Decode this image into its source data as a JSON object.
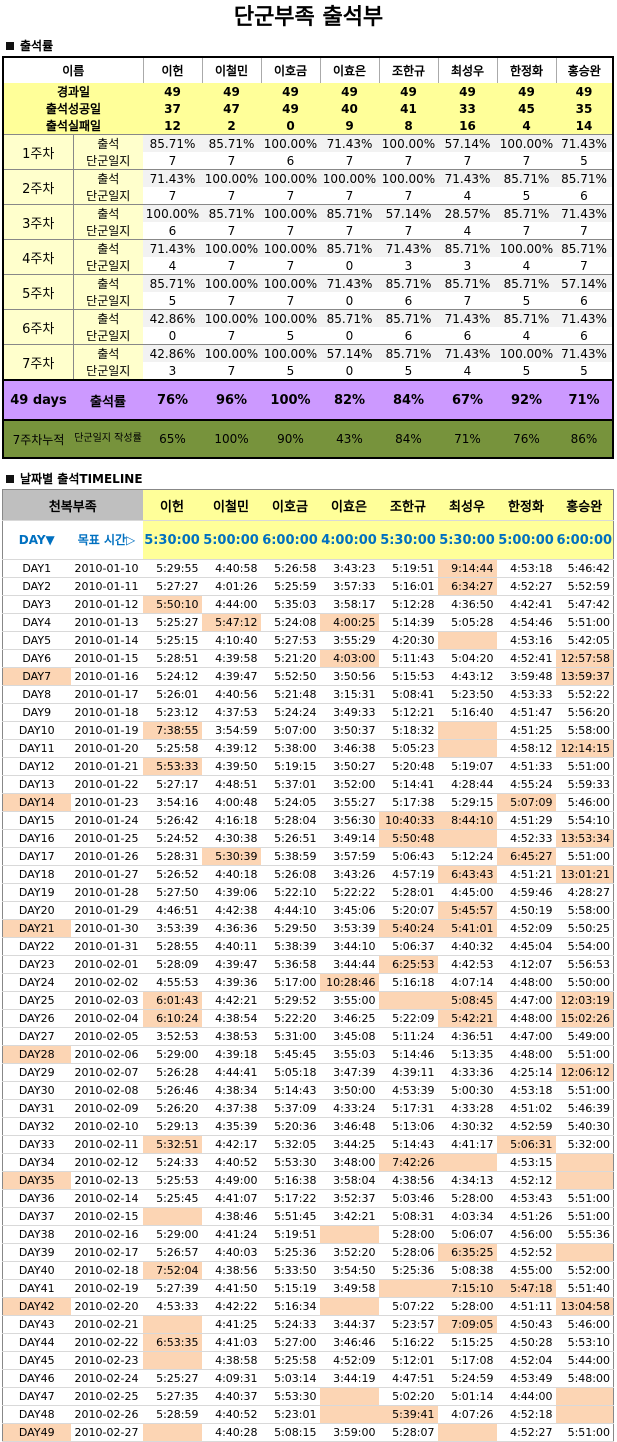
{
  "title": "단군부족 출석부",
  "summary": {
    "section_label": "출석률",
    "name_header": "이름",
    "names": [
      "이헌",
      "이철민",
      "이호금",
      "이효은",
      "조한규",
      "최성우",
      "한정화",
      "홍승완"
    ],
    "rows": [
      {
        "label": "경과일",
        "values": [
          "49",
          "49",
          "49",
          "49",
          "49",
          "49",
          "49",
          "49"
        ]
      },
      {
        "label": "출석성공일",
        "values": [
          "37",
          "47",
          "49",
          "40",
          "41",
          "33",
          "45",
          "35"
        ]
      },
      {
        "label": "출석실패일",
        "values": [
          "12",
          "2",
          "0",
          "9",
          "8",
          "16",
          "4",
          "14"
        ]
      }
    ],
    "attend_label": "출석",
    "journal_label": "단군일지",
    "weeks": [
      {
        "label": "1주차",
        "attend": [
          "85.71%",
          "85.71%",
          "100.00%",
          "71.43%",
          "100.00%",
          "57.14%",
          "100.00%",
          "71.43%"
        ],
        "journal": [
          "7",
          "7",
          "6",
          "7",
          "7",
          "7",
          "7",
          "5"
        ]
      },
      {
        "label": "2주차",
        "attend": [
          "71.43%",
          "100.00%",
          "100.00%",
          "100.00%",
          "100.00%",
          "71.43%",
          "85.71%",
          "85.71%"
        ],
        "journal": [
          "7",
          "7",
          "7",
          "7",
          "7",
          "4",
          "5",
          "6"
        ]
      },
      {
        "label": "3주차",
        "attend": [
          "100.00%",
          "85.71%",
          "100.00%",
          "85.71%",
          "57.14%",
          "28.57%",
          "85.71%",
          "71.43%"
        ],
        "journal": [
          "6",
          "7",
          "7",
          "7",
          "7",
          "4",
          "7",
          "7"
        ]
      },
      {
        "label": "4주차",
        "attend": [
          "71.43%",
          "100.00%",
          "100.00%",
          "85.71%",
          "71.43%",
          "85.71%",
          "100.00%",
          "85.71%"
        ],
        "journal": [
          "4",
          "7",
          "7",
          "0",
          "3",
          "3",
          "4",
          "7"
        ]
      },
      {
        "label": "5주차",
        "attend": [
          "85.71%",
          "100.00%",
          "100.00%",
          "71.43%",
          "85.71%",
          "85.71%",
          "85.71%",
          "57.14%"
        ],
        "journal": [
          "5",
          "7",
          "7",
          "0",
          "6",
          "7",
          "5",
          "6"
        ]
      },
      {
        "label": "6주차",
        "attend": [
          "42.86%",
          "100.00%",
          "100.00%",
          "85.71%",
          "85.71%",
          "71.43%",
          "85.71%",
          "71.43%"
        ],
        "journal": [
          "0",
          "7",
          "5",
          "0",
          "6",
          "6",
          "4",
          "6"
        ]
      },
      {
        "label": "7주차",
        "attend": [
          "42.86%",
          "100.00%",
          "100.00%",
          "57.14%",
          "85.71%",
          "71.43%",
          "100.00%",
          "71.43%"
        ],
        "journal": [
          "3",
          "7",
          "5",
          "0",
          "5",
          "4",
          "5",
          "5"
        ]
      }
    ],
    "total": {
      "days_label": "49 days",
      "rate_label": "출석률",
      "values": [
        "76%",
        "96%",
        "100%",
        "82%",
        "84%",
        "67%",
        "92%",
        "71%"
      ]
    },
    "cumulative": {
      "label": "7주차누적",
      "sublabel": "단군일지 작성률",
      "values": [
        "65%",
        "100%",
        "90%",
        "43%",
        "84%",
        "71%",
        "76%",
        "86%"
      ]
    }
  },
  "timeline": {
    "section_label": "날짜별 출석TIMELINE",
    "group_header": "천복부족",
    "names": [
      "이헌",
      "이철민",
      "이호금",
      "이효은",
      "조한규",
      "최성우",
      "한정화",
      "홍승완"
    ],
    "day_header": "DAY▼",
    "goal_header": "목표 시간▷",
    "targets": [
      "5:30:00",
      "5:00:00",
      "6:00:00",
      "4:00:00",
      "5:30:00",
      "5:30:00",
      "5:00:00",
      "6:00:00"
    ],
    "colors": {
      "highlight": "#fcd5b4",
      "target_bg": "#ffff99",
      "purple": "#cc99ff",
      "green": "#77933c"
    },
    "days": [
      {
        "day": "DAY1",
        "date": "2010-01-10",
        "times": [
          "5:29:55",
          "4:40:58",
          "5:26:58",
          "3:43:23",
          "5:19:51",
          "9:14:44",
          "4:53:18",
          "5:46:42"
        ],
        "hl": [
          5
        ]
      },
      {
        "day": "DAY2",
        "date": "2010-01-11",
        "times": [
          "5:27:27",
          "4:01:26",
          "5:25:59",
          "3:57:33",
          "5:16:01",
          "6:34:27",
          "4:52:27",
          "5:52:59"
        ],
        "hl": [
          5
        ]
      },
      {
        "day": "DAY3",
        "date": "2010-01-12",
        "times": [
          "5:50:10",
          "4:44:00",
          "5:35:03",
          "3:58:17",
          "5:12:28",
          "4:36:50",
          "4:42:41",
          "5:47:42"
        ],
        "hl": [
          0
        ]
      },
      {
        "day": "DAY4",
        "date": "2010-01-13",
        "times": [
          "5:25:27",
          "5:47:12",
          "5:24:08",
          "4:00:25",
          "5:14:39",
          "5:05:28",
          "4:54:46",
          "5:51:00"
        ],
        "hl": [
          1,
          3
        ]
      },
      {
        "day": "DAY5",
        "date": "2010-01-14",
        "times": [
          "5:25:15",
          "4:10:40",
          "5:27:53",
          "3:55:29",
          "4:20:30",
          "",
          "4:53:16",
          "5:42:05"
        ],
        "hl": [
          5
        ]
      },
      {
        "day": "DAY6",
        "date": "2010-01-15",
        "times": [
          "5:28:51",
          "4:39:58",
          "5:21:20",
          "4:03:00",
          "5:11:43",
          "5:04:20",
          "4:52:41",
          "12:57:58"
        ],
        "hl": [
          3,
          7
        ]
      },
      {
        "day": "DAY7",
        "date": "2010-01-16",
        "times": [
          "5:24:12",
          "4:39:47",
          "5:52:50",
          "3:50:56",
          "5:15:53",
          "4:43:12",
          "3:59:48",
          "13:59:37"
        ],
        "hl": [
          7
        ],
        "dhl": true
      },
      {
        "day": "DAY8",
        "date": "2010-01-17",
        "times": [
          "5:26:01",
          "4:40:56",
          "5:21:48",
          "3:15:31",
          "5:08:41",
          "5:23:50",
          "4:53:33",
          "5:52:22"
        ],
        "hl": []
      },
      {
        "day": "DAY9",
        "date": "2010-01-18",
        "times": [
          "5:23:12",
          "4:37:53",
          "5:24:24",
          "3:49:33",
          "5:12:21",
          "5:16:40",
          "4:51:47",
          "5:56:20"
        ],
        "hl": []
      },
      {
        "day": "DAY10",
        "date": "2010-01-19",
        "times": [
          "7:38:55",
          "3:54:59",
          "5:07:00",
          "3:50:37",
          "5:18:32",
          "",
          "4:51:25",
          "5:58:00"
        ],
        "hl": [
          0,
          5
        ]
      },
      {
        "day": "DAY11",
        "date": "2010-01-20",
        "times": [
          "5:25:58",
          "4:39:12",
          "5:38:00",
          "3:46:38",
          "5:05:23",
          "",
          "4:58:12",
          "12:14:15"
        ],
        "hl": [
          5,
          7
        ]
      },
      {
        "day": "DAY12",
        "date": "2010-01-21",
        "times": [
          "5:53:33",
          "4:39:50",
          "5:19:15",
          "3:50:27",
          "5:20:48",
          "5:19:07",
          "4:51:33",
          "5:51:00"
        ],
        "hl": [
          0
        ]
      },
      {
        "day": "DAY13",
        "date": "2010-01-22",
        "times": [
          "5:27:17",
          "4:48:51",
          "5:37:01",
          "3:52:00",
          "5:14:41",
          "4:28:44",
          "4:55:24",
          "5:59:33"
        ],
        "hl": []
      },
      {
        "day": "DAY14",
        "date": "2010-01-23",
        "times": [
          "3:54:16",
          "4:00:48",
          "5:24:05",
          "3:55:27",
          "5:17:38",
          "5:29:15",
          "5:07:09",
          "5:46:00"
        ],
        "hl": [
          6
        ],
        "dhl": true
      },
      {
        "day": "DAY15",
        "date": "2010-01-24",
        "times": [
          "5:26:42",
          "4:16:18",
          "5:28:04",
          "3:56:30",
          "10:40:33",
          "8:44:10",
          "4:51:29",
          "5:54:10"
        ],
        "hl": [
          4,
          5
        ]
      },
      {
        "day": "DAY16",
        "date": "2010-01-25",
        "times": [
          "5:24:52",
          "4:30:38",
          "5:26:51",
          "3:49:14",
          "5:50:48",
          "",
          "4:52:33",
          "13:53:34"
        ],
        "hl": [
          4,
          5,
          7
        ]
      },
      {
        "day": "DAY17",
        "date": "2010-01-26",
        "times": [
          "5:28:31",
          "5:30:39",
          "5:38:59",
          "3:57:59",
          "5:06:43",
          "5:12:24",
          "6:45:27",
          "5:51:00"
        ],
        "hl": [
          1,
          6
        ]
      },
      {
        "day": "DAY18",
        "date": "2010-01-27",
        "times": [
          "5:26:52",
          "4:40:18",
          "5:26:08",
          "3:43:26",
          "4:57:19",
          "6:43:43",
          "4:51:21",
          "13:01:21"
        ],
        "hl": [
          5,
          7
        ]
      },
      {
        "day": "DAY19",
        "date": "2010-01-28",
        "times": [
          "5:27:50",
          "4:39:06",
          "5:22:10",
          "5:22:22",
          "5:28:01",
          "4:45:00",
          "4:59:46",
          "4:28:27"
        ],
        "hl": []
      },
      {
        "day": "DAY20",
        "date": "2010-01-29",
        "times": [
          "4:46:51",
          "4:42:38",
          "4:44:10",
          "3:45:06",
          "5:20:07",
          "5:45:57",
          "4:50:19",
          "5:58:00"
        ],
        "hl": [
          5
        ]
      },
      {
        "day": "DAY21",
        "date": "2010-01-30",
        "times": [
          "3:53:39",
          "4:36:36",
          "5:29:50",
          "3:53:39",
          "5:40:24",
          "5:41:01",
          "4:52:09",
          "5:50:25"
        ],
        "hl": [
          4,
          5
        ],
        "dhl": true
      },
      {
        "day": "DAY22",
        "date": "2010-01-31",
        "times": [
          "5:28:55",
          "4:40:11",
          "5:38:39",
          "3:44:10",
          "5:06:37",
          "4:40:32",
          "4:45:04",
          "5:54:00"
        ],
        "hl": []
      },
      {
        "day": "DAY23",
        "date": "2010-02-01",
        "times": [
          "5:28:09",
          "4:39:47",
          "5:36:58",
          "3:44:44",
          "6:25:53",
          "4:42:53",
          "4:12:07",
          "5:56:53"
        ],
        "hl": [
          4
        ]
      },
      {
        "day": "DAY24",
        "date": "2010-02-02",
        "times": [
          "4:55:53",
          "4:39:36",
          "5:17:00",
          "10:28:46",
          "5:16:18",
          "4:07:14",
          "4:48:00",
          "5:50:00"
        ],
        "hl": [
          3
        ]
      },
      {
        "day": "DAY25",
        "date": "2010-02-03",
        "times": [
          "6:01:43",
          "4:42:21",
          "5:29:52",
          "3:55:00",
          "",
          "5:08:45",
          "4:47:00",
          "12:03:19"
        ],
        "hl": [
          0,
          4,
          5,
          7
        ]
      },
      {
        "day": "DAY26",
        "date": "2010-02-04",
        "times": [
          "6:10:24",
          "4:38:54",
          "5:22:20",
          "3:46:25",
          "5:22:09",
          "5:42:21",
          "4:48:00",
          "15:02:26"
        ],
        "hl": [
          0,
          5,
          7
        ]
      },
      {
        "day": "DAY27",
        "date": "2010-02-05",
        "times": [
          "3:52:53",
          "4:38:53",
          "5:31:00",
          "3:45:08",
          "5:11:24",
          "4:36:51",
          "4:47:00",
          "5:49:00"
        ],
        "hl": []
      },
      {
        "day": "DAY28",
        "date": "2010-02-06",
        "times": [
          "5:29:00",
          "4:39:18",
          "5:45:45",
          "3:55:03",
          "5:14:46",
          "5:13:35",
          "4:48:00",
          "5:51:00"
        ],
        "hl": [],
        "dhl": true
      },
      {
        "day": "DAY29",
        "date": "2010-02-07",
        "times": [
          "5:26:28",
          "4:44:41",
          "5:05:18",
          "3:47:39",
          "4:39:11",
          "4:33:36",
          "4:25:14",
          "12:06:12"
        ],
        "hl": [
          7
        ]
      },
      {
        "day": "DAY30",
        "date": "2010-02-08",
        "times": [
          "5:26:46",
          "4:38:34",
          "5:14:43",
          "3:50:00",
          "4:53:39",
          "5:00:30",
          "4:53:18",
          "5:51:00"
        ],
        "hl": []
      },
      {
        "day": "DAY31",
        "date": "2010-02-09",
        "times": [
          "5:26:20",
          "4:37:38",
          "5:37:09",
          "4:33:24",
          "5:17:31",
          "4:33:28",
          "4:51:02",
          "5:46:39"
        ],
        "hl": []
      },
      {
        "day": "DAY32",
        "date": "2010-02-10",
        "times": [
          "5:29:13",
          "4:35:39",
          "5:20:36",
          "3:46:48",
          "5:13:06",
          "4:30:32",
          "4:52:59",
          "5:40:30"
        ],
        "hl": []
      },
      {
        "day": "DAY33",
        "date": "2010-02-11",
        "times": [
          "5:32:51",
          "4:42:17",
          "5:32:05",
          "3:44:25",
          "5:14:43",
          "4:41:17",
          "5:06:31",
          "5:32:00"
        ],
        "hl": [
          0,
          6
        ]
      },
      {
        "day": "DAY34",
        "date": "2010-02-12",
        "times": [
          "5:24:33",
          "4:40:52",
          "5:53:30",
          "3:48:00",
          "7:42:26",
          "",
          "4:53:15",
          ""
        ],
        "hl": [
          4,
          5,
          7
        ]
      },
      {
        "day": "DAY35",
        "date": "2010-02-13",
        "times": [
          "5:25:53",
          "4:49:00",
          "5:16:38",
          "3:58:04",
          "4:38:56",
          "4:34:13",
          "4:52:12",
          ""
        ],
        "hl": [
          7
        ],
        "dhl": true
      },
      {
        "day": "DAY36",
        "date": "2010-02-14",
        "times": [
          "5:25:45",
          "4:41:07",
          "5:17:22",
          "3:52:37",
          "5:03:46",
          "5:28:00",
          "4:53:43",
          "5:51:00"
        ],
        "hl": []
      },
      {
        "day": "DAY37",
        "date": "2010-02-15",
        "times": [
          "",
          "4:38:46",
          "5:51:45",
          "3:42:21",
          "5:08:31",
          "4:03:34",
          "4:51:26",
          "5:51:00"
        ],
        "hl": [
          0
        ]
      },
      {
        "day": "DAY38",
        "date": "2010-02-16",
        "times": [
          "5:29:00",
          "4:41:24",
          "5:19:51",
          "",
          "5:28:00",
          "5:06:07",
          "4:56:00",
          "5:55:36"
        ],
        "hl": [
          3
        ]
      },
      {
        "day": "DAY39",
        "date": "2010-02-17",
        "times": [
          "5:26:57",
          "4:40:03",
          "5:25:36",
          "3:52:20",
          "5:28:06",
          "6:35:25",
          "4:52:52",
          ""
        ],
        "hl": [
          5,
          7
        ]
      },
      {
        "day": "DAY40",
        "date": "2010-02-18",
        "times": [
          "7:52:04",
          "4:38:56",
          "5:33:50",
          "3:54:50",
          "5:25:36",
          "5:08:38",
          "4:55:00",
          "5:52:00"
        ],
        "hl": [
          0
        ]
      },
      {
        "day": "DAY41",
        "date": "2010-02-19",
        "times": [
          "5:27:39",
          "4:41:50",
          "5:15:19",
          "3:49:58",
          "",
          "7:15:10",
          "5:47:18",
          "5:51:40"
        ],
        "hl": [
          4,
          5,
          6
        ]
      },
      {
        "day": "DAY42",
        "date": "2010-02-20",
        "times": [
          "4:53:33",
          "4:42:22",
          "5:16:34",
          "",
          "5:07:22",
          "5:28:00",
          "4:51:11",
          "13:04:58"
        ],
        "hl": [
          3,
          7
        ],
        "dhl": true
      },
      {
        "day": "DAY43",
        "date": "2010-02-21",
        "times": [
          "",
          "4:41:25",
          "5:24:33",
          "3:44:37",
          "5:23:57",
          "7:09:05",
          "4:50:43",
          "5:46:00"
        ],
        "hl": [
          0,
          5
        ]
      },
      {
        "day": "DAY44",
        "date": "2010-02-22",
        "times": [
          "6:53:35",
          "4:41:03",
          "5:27:00",
          "3:46:46",
          "5:16:22",
          "5:15:25",
          "4:50:28",
          "5:53:10"
        ],
        "hl": [
          0
        ]
      },
      {
        "day": "DAY45",
        "date": "2010-02-23",
        "times": [
          "",
          "4:38:58",
          "5:25:58",
          "4:52:09",
          "5:12:01",
          "5:17:08",
          "4:52:04",
          "5:44:00"
        ],
        "hl": [
          0
        ]
      },
      {
        "day": "DAY46",
        "date": "2010-02-24",
        "times": [
          "5:25:27",
          "4:09:31",
          "5:03:14",
          "3:44:19",
          "4:47:51",
          "5:24:59",
          "4:53:49",
          "5:48:00"
        ],
        "hl": []
      },
      {
        "day": "DAY47",
        "date": "2010-02-25",
        "times": [
          "5:27:35",
          "4:40:37",
          "5:53:30",
          "",
          "5:02:20",
          "5:01:14",
          "4:44:00",
          ""
        ],
        "hl": [
          3,
          7
        ]
      },
      {
        "day": "DAY48",
        "date": "2010-02-26",
        "times": [
          "5:28:59",
          "4:40:52",
          "5:23:01",
          "",
          "5:39:41",
          "4:07:26",
          "4:52:18",
          ""
        ],
        "hl": [
          3,
          4,
          7
        ]
      },
      {
        "day": "DAY49",
        "date": "2010-02-27",
        "times": [
          "",
          "4:40:28",
          "5:08:15",
          "3:59:00",
          "5:28:07",
          "",
          "4:52:27",
          "5:51:00"
        ],
        "hl": [
          0,
          5
        ],
        "dhl": true
      }
    ]
  }
}
